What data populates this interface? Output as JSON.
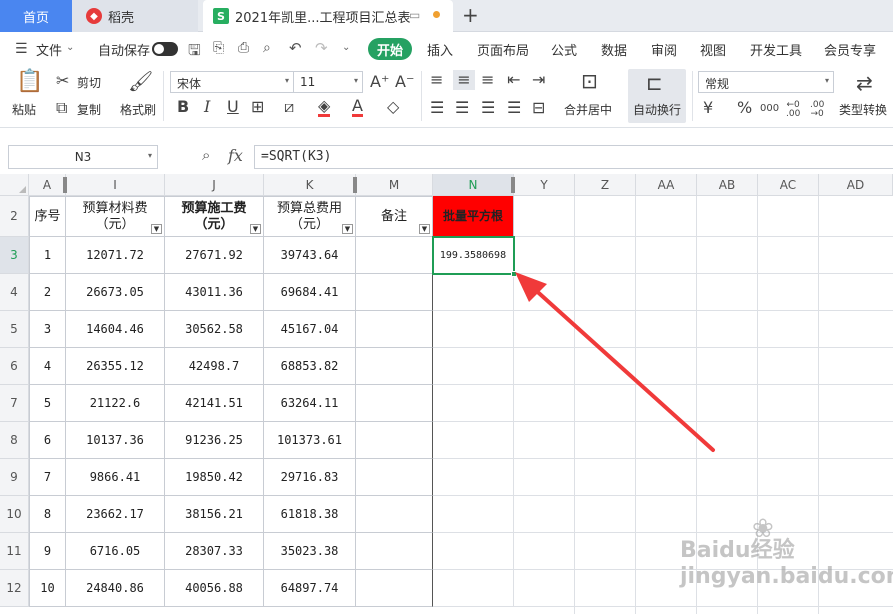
{
  "tabs": {
    "home": "首页",
    "docer": "稻壳",
    "file_icon": "S",
    "file_title": "2021年凯里...工程项目汇总表",
    "add": "+"
  },
  "menu": {
    "file": "文件",
    "autosave": "自动保存",
    "start": "开始",
    "items": [
      "插入",
      "页面布局",
      "公式",
      "数据",
      "审阅",
      "视图",
      "开发工具",
      "会员专享"
    ]
  },
  "ribbon": {
    "paste": "粘贴",
    "cut": "剪切",
    "copy": "复制",
    "format_painter": "格式刷",
    "font_name": "宋体",
    "font_size": "11",
    "merge_center": "合并居中",
    "wrap_text": "自动换行",
    "number_format": "常规",
    "type_convert": "类型转换"
  },
  "formula_bar": {
    "cell_ref": "N3",
    "fx": "fx",
    "formula": "=SQRT(K3)"
  },
  "columns": [
    "A",
    "I",
    "J",
    "K",
    "M",
    "N",
    "Y",
    "Z",
    "AA",
    "AB",
    "AC",
    "AD"
  ],
  "rows": [
    "2",
    "3",
    "4",
    "5",
    "6",
    "7",
    "8",
    "9",
    "10",
    "11",
    "12"
  ],
  "header_row": {
    "a": "序号",
    "i": [
      "预算材料费",
      "（元）"
    ],
    "j": [
      "预算施工费",
      "（元）"
    ],
    "k": [
      "预算总费用",
      "（元）"
    ],
    "m": "备注",
    "n": "批量平方根"
  },
  "data_rows": [
    {
      "a": "1",
      "i": "12071.72",
      "j": "27671.92",
      "k": "39743.64",
      "n": "199.3580698"
    },
    {
      "a": "2",
      "i": "26673.05",
      "j": "43011.36",
      "k": "69684.41",
      "n": ""
    },
    {
      "a": "3",
      "i": "14604.46",
      "j": "30562.58",
      "k": "45167.04",
      "n": ""
    },
    {
      "a": "4",
      "i": "26355.12",
      "j": "42498.7",
      "k": "68853.82",
      "n": ""
    },
    {
      "a": "5",
      "i": "21122.6",
      "j": "42141.51",
      "k": "63264.11",
      "n": ""
    },
    {
      "a": "6",
      "i": "10137.36",
      "j": "91236.25",
      "k": "101373.61",
      "n": ""
    },
    {
      "a": "7",
      "i": "9866.41",
      "j": "19850.42",
      "k": "29716.83",
      "n": ""
    },
    {
      "a": "8",
      "i": "23662.17",
      "j": "38156.21",
      "k": "61818.38",
      "n": ""
    },
    {
      "a": "9",
      "i": "6716.05",
      "j": "28307.33",
      "k": "35023.38",
      "n": ""
    },
    {
      "a": "10",
      "i": "24840.86",
      "j": "40056.88",
      "k": "64897.74",
      "n": ""
    }
  ],
  "colors": {
    "accent": "#25a162",
    "highlight_header": "#ff0000",
    "selection": "#1f9d55",
    "annotation_arrow": "#f03a3a"
  },
  "watermark": "Baidu经验 jingyan.baidu.com"
}
